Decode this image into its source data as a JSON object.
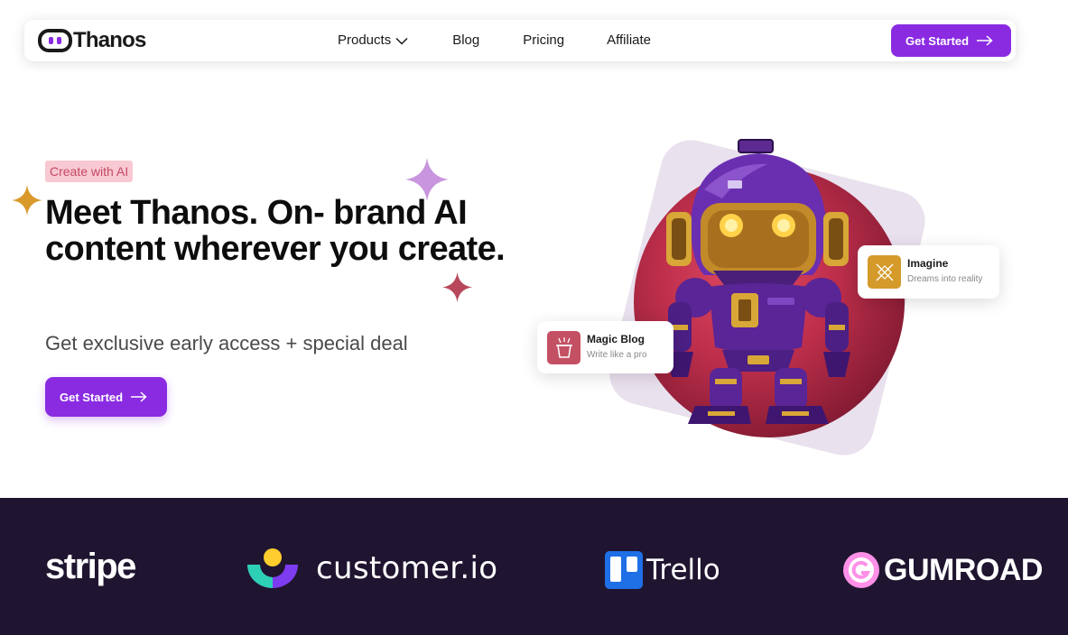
{
  "nav": {
    "logo_text": "Thanos",
    "links": [
      {
        "label": "Products",
        "has_dropdown": true
      },
      {
        "label": "Blog"
      },
      {
        "label": "Pricing"
      },
      {
        "label": "Affiliate"
      }
    ],
    "cta_label": "Get Started"
  },
  "hero": {
    "badge": "Create with AI",
    "headline": "Meet Thanos. On- brand AI content wherever you create.",
    "subhead": "Get exclusive early access + special deal",
    "cta_label": "Get Started"
  },
  "cards": {
    "blog": {
      "title": "Magic Blog",
      "subtitle": "Write like a pro"
    },
    "imagine": {
      "title": "Imagine",
      "subtitle": "Dreams into reality"
    }
  },
  "logos": {
    "stripe": "stripe",
    "customer": "customer.io",
    "trello": "Trello",
    "gumroad": "GUMROAD"
  },
  "colors": {
    "accent": "#8a2be2",
    "badge_bg": "#f8c9d2",
    "badge_text": "#c44866",
    "strip_bg": "#1f1530"
  }
}
